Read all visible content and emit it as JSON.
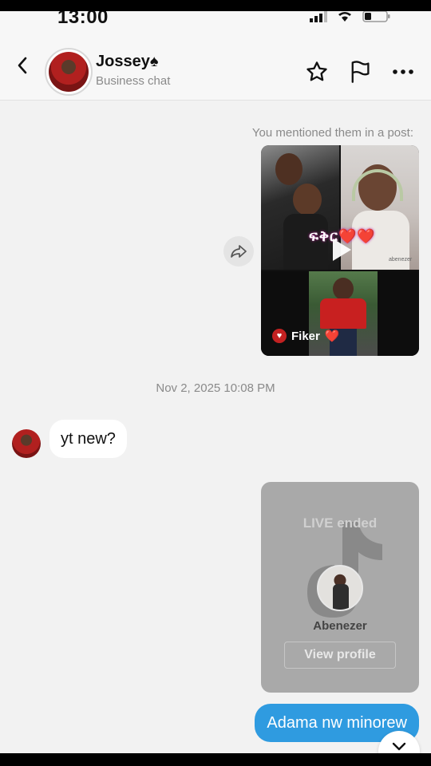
{
  "status_bar": {
    "time": "13:00"
  },
  "header": {
    "contact_name": "Jossey♠",
    "subtitle": "Business chat",
    "icons": [
      "back-icon",
      "star-icon",
      "flag-icon",
      "more-icon"
    ]
  },
  "messages": {
    "mention_note": "You mentioned them in a post:",
    "post": {
      "overlay_text": "ፍቅር❤️❤️",
      "creator": "Fiker",
      "creator_emoji": "❤️",
      "watermark": "abenezer"
    },
    "timestamp": "Nov 2, 2025 10:08 PM",
    "incoming_text": "yt new?",
    "live_card": {
      "title": "LIVE ended",
      "name": "Abenezer",
      "button_label": "View profile"
    },
    "outgoing_text": "Adama nw minorew"
  },
  "colors": {
    "accent": "#2f9be0",
    "live_card_bg": "#a9a9a9",
    "screen_bg": "#f2f2f2"
  }
}
